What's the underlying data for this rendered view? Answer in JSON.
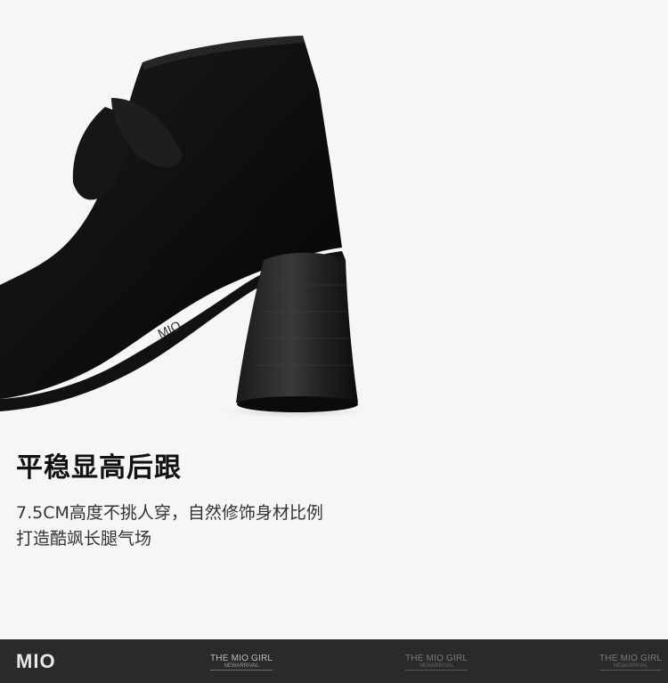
{
  "headline": "平稳显高后跟",
  "description": {
    "line1": "7.5CM高度不挑人穿，自然修饰身材比例",
    "line2": "打造酷飒长腿气场"
  },
  "footer": {
    "logo": "MIO",
    "watermarks": [
      {
        "title": "THE MIO GIRL",
        "subtitle": "NEWARRIVAL"
      },
      {
        "title": "THE MIO GIRL",
        "subtitle": "NEWARRIVAL"
      },
      {
        "title": "THE MIO GIRL",
        "subtitle": "NEWARRIVAL"
      }
    ]
  },
  "colors": {
    "background": "#f6f6f6",
    "footer": "#2a2a2a",
    "boot": "#0d0d0d"
  }
}
